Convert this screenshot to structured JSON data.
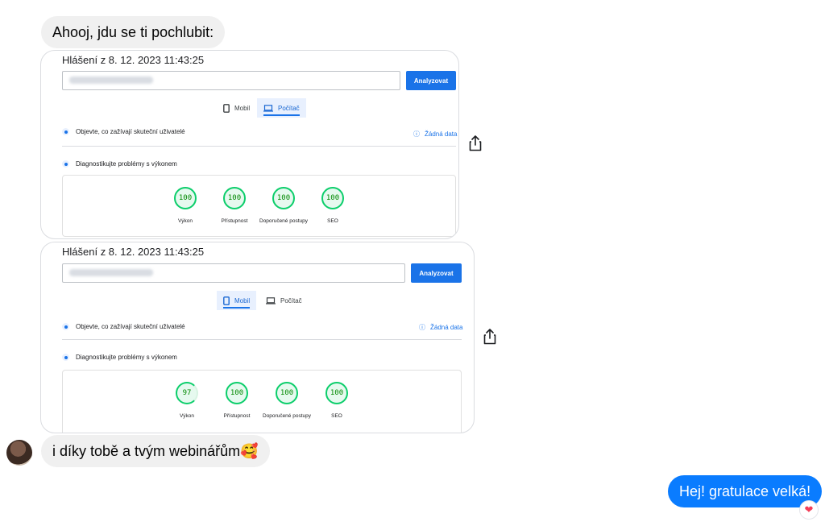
{
  "chat": {
    "messages": {
      "intro": "Ahooj, jdu se ti pochlubit:",
      "thanks": "i díky tobě a tvým webinářům🥰",
      "reply": "Hej! gratulace velká!"
    },
    "reaction": "❤"
  },
  "report_desktop": {
    "header": "Hlášení z 8. 12. 2023 11:43:25",
    "analyze_label": "Analyzovat",
    "tab_mobile": "Mobil",
    "tab_desktop": "Počítač",
    "active_tab": "desktop",
    "real_users": "Objevte, co zažívají skuteční uživatelé",
    "no_data": "Žádná data",
    "diagnose": "Diagnostikujte problémy s výkonem",
    "scores": [
      {
        "value": "100",
        "label": "Výkon"
      },
      {
        "value": "100",
        "label": "Přístupnost"
      },
      {
        "value": "100",
        "label": "Doporučené postupy"
      },
      {
        "value": "100",
        "label": "SEO"
      }
    ]
  },
  "report_mobile": {
    "header": "Hlášení z 8. 12. 2023 11:43:25",
    "analyze_label": "Analyzovat",
    "tab_mobile": "Mobil",
    "tab_desktop": "Počítač",
    "active_tab": "mobile",
    "real_users": "Objevte, co zažívají skuteční uživatelé",
    "no_data": "Žádná data",
    "diagnose": "Diagnostikujte problémy s výkonem",
    "scores": [
      {
        "value": "97",
        "label": "Výkon"
      },
      {
        "value": "100",
        "label": "Přístupnost"
      },
      {
        "value": "100",
        "label": "Doporučené postupy"
      },
      {
        "value": "100",
        "label": "SEO"
      }
    ]
  },
  "colors": {
    "accent": "#1a73e8",
    "good": "#0cce6b",
    "bubble_out": "#0a7cff"
  }
}
